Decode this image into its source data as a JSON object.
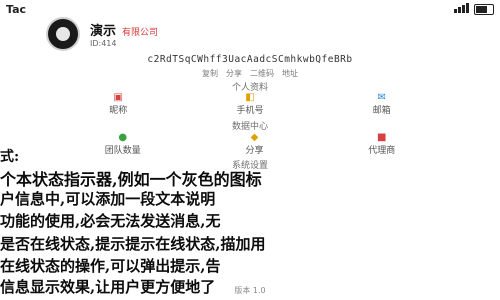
{
  "statusbar": {
    "app_name": "Tac"
  },
  "profile": {
    "name": "演示",
    "tag": "有限公司",
    "uid": "ID:414"
  },
  "address": "c2RdTSqCWhff3UacAadcSCmhkwbQfeBRb",
  "address_buttons": [
    "复制",
    "分享",
    "二维码",
    "地址"
  ],
  "sections": {
    "personal": {
      "title": "个人资料",
      "items": [
        {
          "label": "昵称",
          "icon": "id-card-icon",
          "color": "#d94141"
        },
        {
          "label": "手机号",
          "icon": "phone-icon",
          "color": "#e0a100"
        },
        {
          "label": "邮箱",
          "icon": "mail-icon",
          "color": "#2c8ad6"
        }
      ]
    },
    "data": {
      "title": "数据中心",
      "items": [
        {
          "label": "团队数量",
          "icon": "team-icon",
          "color": "#3aa142"
        },
        {
          "label": "分享",
          "icon": "share-icon",
          "color": "#e0a100"
        },
        {
          "label": "代理商",
          "icon": "agent-icon",
          "color": "#d94141"
        }
      ]
    },
    "system": {
      "title": "系统设置"
    }
  },
  "overlay_lines": [
    "式:",
    "个本状态指示器,例如一个灰色的图标",
    "户信息中,可以添加一段文本说明",
    "功能的使用,必会无法发送消息,无",
    "是否在线状态,提示提示在线状态,描加用",
    "在线状态的操作,可以弹出提示,告",
    "信息显示效果,让用户更方便地了"
  ],
  "footer": "版本 1.0"
}
